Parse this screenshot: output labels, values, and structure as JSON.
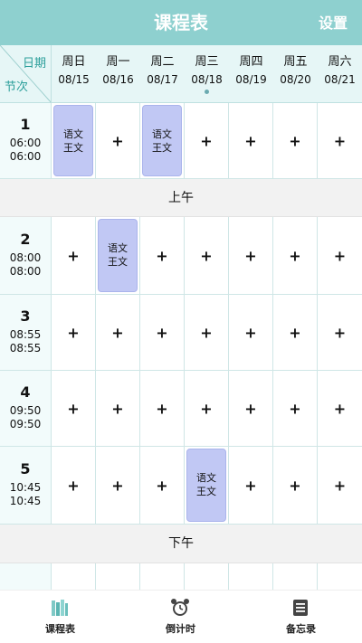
{
  "header": {
    "title": "课程表",
    "settings_label": "设置"
  },
  "grid_header": {
    "date_label": "日期",
    "period_label": "节次",
    "days": [
      {
        "weekday": "周日",
        "date": "08/15"
      },
      {
        "weekday": "周一",
        "date": "08/16"
      },
      {
        "weekday": "周二",
        "date": "08/17"
      },
      {
        "weekday": "周三",
        "date": "08/18",
        "today": true
      },
      {
        "weekday": "周四",
        "date": "08/19"
      },
      {
        "weekday": "周五",
        "date": "08/20"
      },
      {
        "weekday": "周六",
        "date": "08/21"
      }
    ]
  },
  "add_symbol": "+",
  "periods": [
    {
      "number": "1",
      "start": "06:00",
      "end": "06:00",
      "courses": [
        {
          "day": 0,
          "name": "语文",
          "teacher": "王文"
        },
        {
          "day": 2,
          "name": "语文",
          "teacher": "王文"
        }
      ]
    },
    {
      "number": "2",
      "start": "08:00",
      "end": "08:00",
      "courses": [
        {
          "day": 1,
          "name": "语文",
          "teacher": "王文"
        }
      ]
    },
    {
      "number": "3",
      "start": "08:55",
      "end": "08:55",
      "courses": []
    },
    {
      "number": "4",
      "start": "09:50",
      "end": "09:50",
      "courses": []
    },
    {
      "number": "5",
      "start": "10:45",
      "end": "10:45",
      "courses": [
        {
          "day": 3,
          "name": "语文",
          "teacher": "王文"
        }
      ]
    }
  ],
  "sections": {
    "morning": "上午",
    "afternoon": "下午"
  },
  "tabbar": {
    "tabs": [
      {
        "label": "课程表",
        "icon": "books-icon",
        "active": true
      },
      {
        "label": "倒计时",
        "icon": "alarm-clock-icon",
        "active": false
      },
      {
        "label": "备忘录",
        "icon": "memo-list-icon",
        "active": false
      }
    ]
  }
}
